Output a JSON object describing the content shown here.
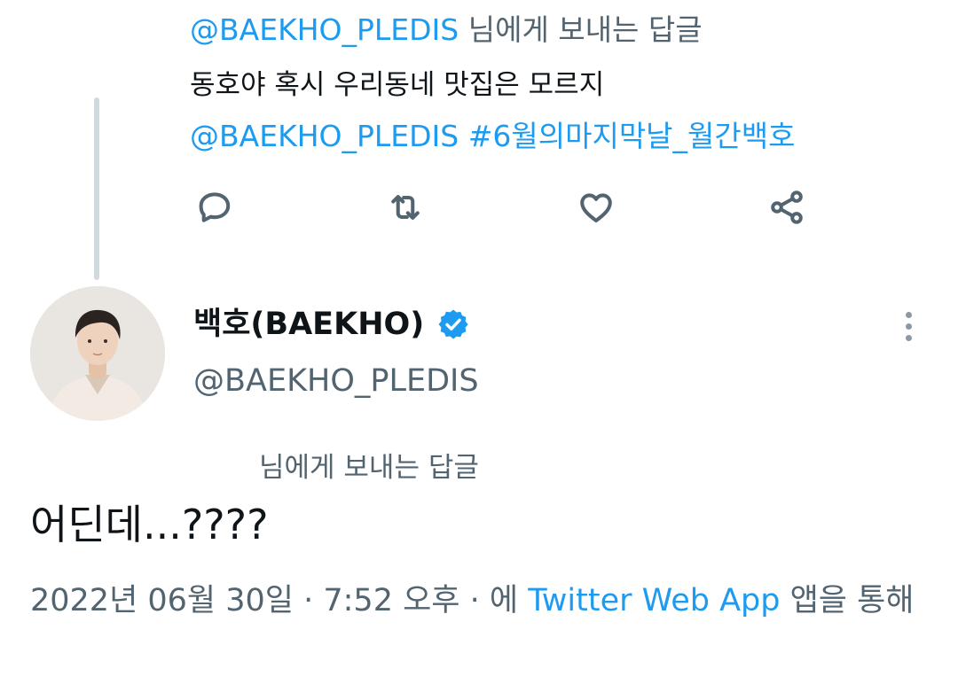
{
  "parent_tweet": {
    "reply_to_handle": "@BAEKHO_PLEDIS",
    "reply_to_suffix": " 님에게 보내는 답글",
    "body_text": "동호야 혹시 우리동네 맛집은 모르지",
    "mention": "@BAEKHO_PLEDIS",
    "hashtag": "#6월의마지막날_월간백호",
    "actions": [
      "reply-icon",
      "retweet-icon",
      "like-icon",
      "share-icon"
    ]
  },
  "author": {
    "display_name": "백호(BAEKHO)",
    "handle": "@BAEKHO_PLEDIS",
    "verified": true,
    "verified_color": "#1d9bf0"
  },
  "tweet": {
    "replying_to": "님에게 보내는 답글",
    "text": "어딘데...????",
    "timestamp": "2022년 06월 30일 · 7:52 오후 · 에 ",
    "source": "Twitter Web App",
    "source_suffix": " 앱을 통해"
  },
  "colors": {
    "link": "#1d9bf0",
    "muted": "#536471",
    "text": "#0f1419"
  }
}
